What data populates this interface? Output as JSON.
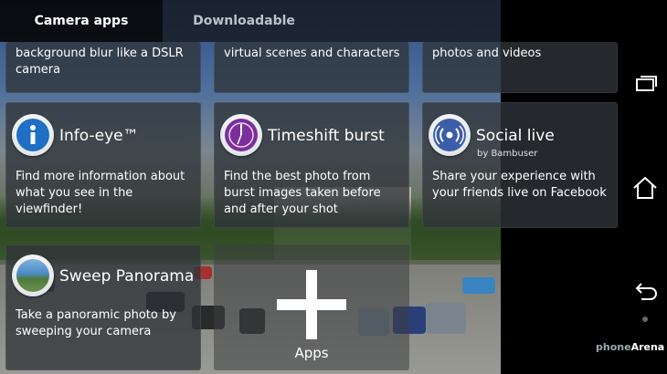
{
  "tabs": [
    {
      "label": "Camera apps",
      "active": true
    },
    {
      "label": "Downloadable",
      "active": false
    }
  ],
  "top_row_partial": [
    {
      "desc": "background blur like a DSLR camera"
    },
    {
      "desc": "virtual scenes and characters"
    },
    {
      "desc": "photos and videos"
    }
  ],
  "apps": [
    {
      "title": "Info-eye™",
      "desc": "Find more information about what you see in the viewfinder!",
      "icon": "info-icon",
      "color": "#1f6fc4"
    },
    {
      "title": "Timeshift burst",
      "desc": "Find the best photo from burst images taken before and after your shot",
      "icon": "clock-icon",
      "color": "#7b2f9c"
    },
    {
      "title": "Social live",
      "subtitle": "by Bambuser",
      "desc": "Share your experience with your friends live on Facebook",
      "icon": "broadcast-icon",
      "color": "#3c5ea8"
    },
    {
      "title": "Sweep Panorama",
      "desc": "Take a panoramic photo by sweeping your camera",
      "icon": "panorama-icon",
      "color": "#4a8bc4"
    }
  ],
  "add_apps": {
    "label": "Apps"
  },
  "watermark": {
    "text1": "phone",
    "text2": "Arena"
  }
}
